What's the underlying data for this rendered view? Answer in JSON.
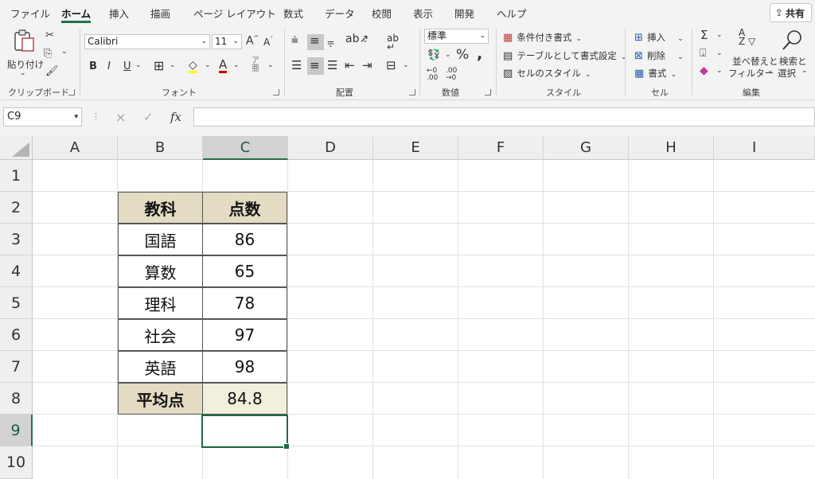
{
  "tabs": [
    "ファイル",
    "ホーム",
    "挿入",
    "描画",
    "ページ レイアウト",
    "数式",
    "データ",
    "校閲",
    "表示",
    "開発",
    "ヘルプ"
  ],
  "active_tab": "ホーム",
  "share_label": "共有",
  "ribbon": {
    "clipboard": {
      "paste": "貼り付け",
      "label": "クリップボード"
    },
    "font": {
      "name": "Calibri",
      "size": "11",
      "label": "フォント",
      "bold": "B",
      "italic": "I",
      "underline": "U"
    },
    "alignment": {
      "label": "配置"
    },
    "number": {
      "format": "標準",
      "label": "数値"
    },
    "styles": {
      "conditional": "条件付き書式",
      "table": "テーブルとして書式設定",
      "cell_styles": "セルのスタイル",
      "label": "スタイル"
    },
    "cells": {
      "insert": "挿入",
      "delete": "削除",
      "format": "書式",
      "label": "セル"
    },
    "editing": {
      "sort_line1": "並べ替えと",
      "sort_line2": "フィルター",
      "find_line1": "検索と",
      "find_line2": "選択",
      "label": "編集"
    }
  },
  "formula_bar": {
    "name_box": "C9",
    "cancel": "×",
    "enter": "✓",
    "fx": "fx",
    "value": ""
  },
  "columns": [
    "A",
    "B",
    "C",
    "D",
    "E",
    "F",
    "G",
    "H",
    "I"
  ],
  "rows": [
    "1",
    "2",
    "3",
    "4",
    "5",
    "6",
    "7",
    "8",
    "9",
    "10"
  ],
  "selected_cell": "C9",
  "table": {
    "header": [
      "教科",
      "点数"
    ],
    "rows": [
      [
        "国語",
        "86"
      ],
      [
        "算数",
        "65"
      ],
      [
        "理科",
        "78"
      ],
      [
        "社会",
        "97"
      ],
      [
        "英語",
        "98"
      ]
    ],
    "footer": [
      "平均点",
      "84.8"
    ]
  },
  "colors": {
    "accent": "#217346",
    "header_fill": "#e3dbc2",
    "average_fill": "#f2efdd"
  }
}
